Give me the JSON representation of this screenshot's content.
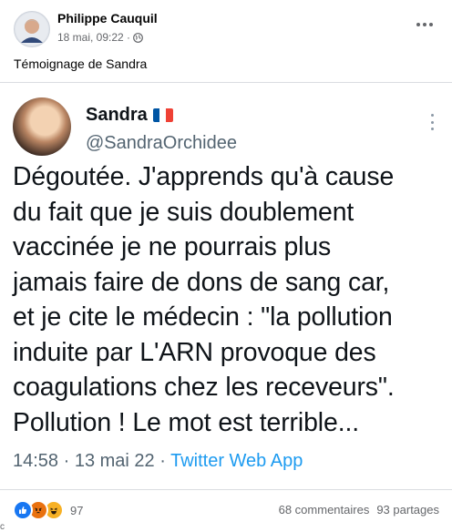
{
  "post": {
    "author": "Philippe Cauquil",
    "timestamp": "18 mai, 09:22 ·",
    "privacy_icon": "globe-icon",
    "text": "Témoignage de Sandra"
  },
  "tweet": {
    "name": "Sandra",
    "flag_icon": "france-flag-icon",
    "handle": "@SandraOrchidee",
    "lines": [
      "Dégoutée. J'apprends qu'à cause",
      "du fait que je suis doublement",
      "vaccinée  je ne pourrais plus",
      "jamais faire de dons de sang car,",
      "et je cite le médecin : \"la pollution",
      "induite par L'ARN provoque des",
      "coagulations chez les receveurs\".",
      "Pollution ! Le mot est terrible..."
    ],
    "time": "14:58 · 13 mai 22 · ",
    "source": "Twitter Web App"
  },
  "stats": {
    "reaction_icons": [
      "like-icon",
      "angry-icon",
      "haha-icon"
    ],
    "reaction_count": "97",
    "comments": "68 commentaires",
    "shares": "93 partages"
  },
  "colors": {
    "facebook_meta": "#65676b",
    "twitter_blue": "#1d9bf0",
    "twitter_gray": "#536471",
    "like_blue": "#1877f2",
    "angry_orange": "#e9710f",
    "haha_yellow": "#f7b125"
  },
  "partial_text": "c"
}
